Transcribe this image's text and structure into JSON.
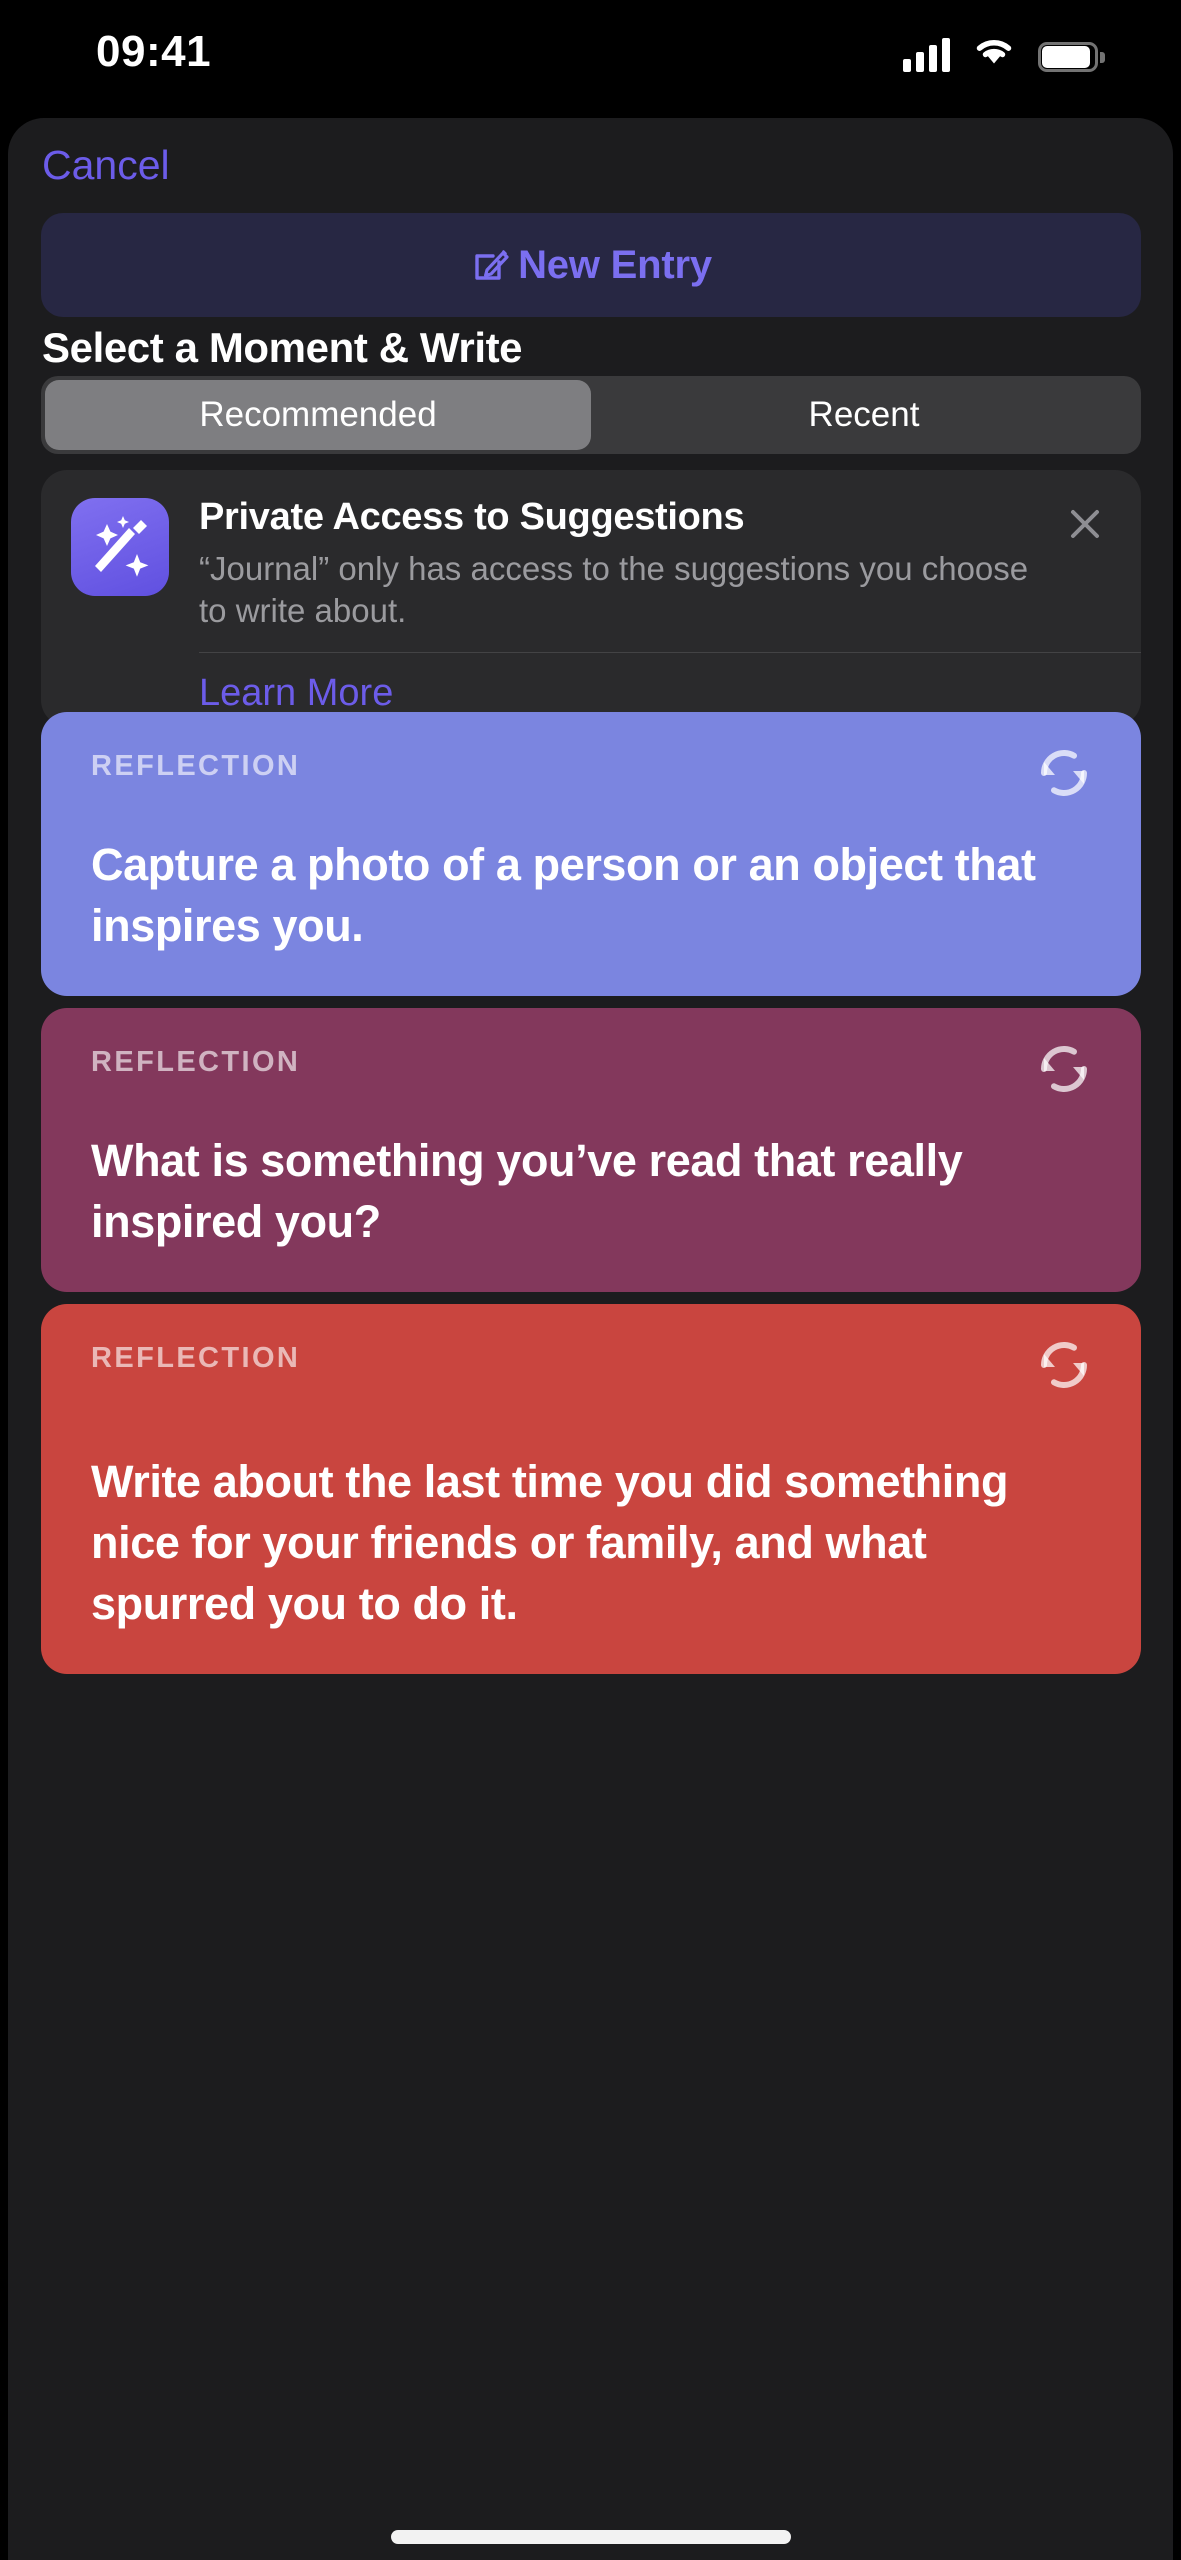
{
  "status_bar": {
    "time": "09:41",
    "cellular_icon": "cellular-bars-icon",
    "wifi_icon": "wifi-icon",
    "battery_icon": "battery-icon"
  },
  "sheet": {
    "cancel_label": "Cancel",
    "new_entry": {
      "label": "New Entry",
      "icon": "square-and-pencil-icon",
      "accent_color": "#7b6ff0",
      "background_color": "#272743"
    },
    "section_title": "Select a Moment & Write",
    "segmented_control": {
      "options": [
        {
          "label": "Recommended",
          "selected": true
        },
        {
          "label": "Recent",
          "selected": false
        }
      ]
    },
    "privacy_card": {
      "icon": "magic-wand-sparkles-icon",
      "title": "Private Access to Suggestions",
      "body": "“Journal” only has access to the suggestions you choose to write about.",
      "learn_more_label": "Learn More",
      "close_icon": "close-icon",
      "accent_color": "#6c5ce9"
    },
    "suggestion_cards": [
      {
        "kicker": "REFLECTION",
        "text": "Capture a photo of a person or an object that inspires you.",
        "color": "#7b85e0",
        "refresh_icon": "refresh-icon"
      },
      {
        "kicker": "REFLECTION",
        "text": "What is something you’ve read that really inspired you?",
        "color": "#83385c",
        "refresh_icon": "refresh-icon"
      },
      {
        "kicker": "REFLECTION",
        "text": "Write about the last time you did something nice for your friends or family, and what spurred you to do it.",
        "color": "#c9453f",
        "refresh_icon": "refresh-icon"
      }
    ]
  },
  "home_indicator": "home-indicator"
}
